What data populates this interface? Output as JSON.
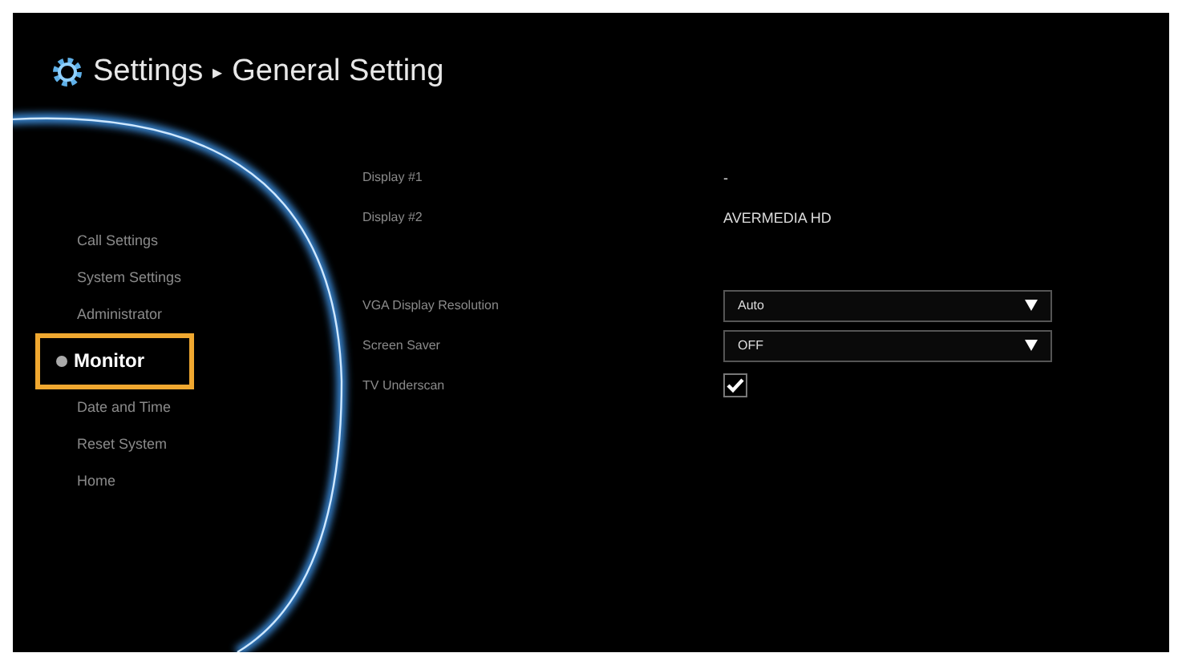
{
  "header": {
    "title": "Settings",
    "separator": "▸",
    "subtitle": "General Setting"
  },
  "sidebar": {
    "items": [
      {
        "label": "Call Settings",
        "selected": false
      },
      {
        "label": "System Settings",
        "selected": false
      },
      {
        "label": "Administrator",
        "selected": false
      },
      {
        "label": "Monitor",
        "selected": true
      },
      {
        "label": "Date and Time",
        "selected": false
      },
      {
        "label": "Reset System",
        "selected": false
      },
      {
        "label": "Home",
        "selected": false
      }
    ]
  },
  "settings": [
    {
      "kind": "value",
      "label": "Display #1",
      "value": "-"
    },
    {
      "kind": "value",
      "label": "Display #2",
      "value": "AVERMEDIA HD"
    },
    {
      "kind": "spacer"
    },
    {
      "kind": "dropdown",
      "label": "VGA Display Resolution",
      "value": "Auto"
    },
    {
      "kind": "dropdown",
      "label": "Screen Saver",
      "value": "OFF"
    },
    {
      "kind": "checkbox",
      "label": "TV Underscan",
      "checked": true
    }
  ]
}
